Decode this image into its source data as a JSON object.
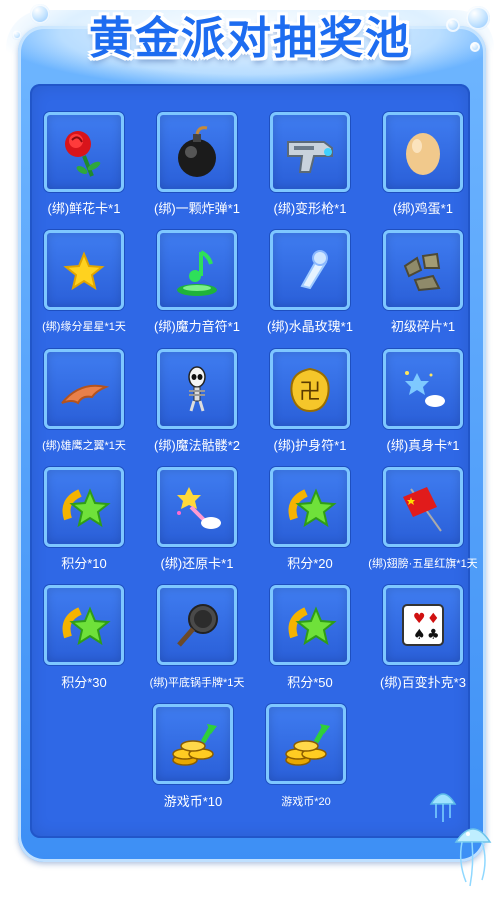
{
  "title": "黄金派对抽奖池",
  "items": [
    {
      "label": "(绑)鲜花卡*1",
      "icon": "rose-icon"
    },
    {
      "label": "(绑)一颗炸弹*1",
      "icon": "bomb-icon"
    },
    {
      "label": "(绑)变形枪*1",
      "icon": "transform-gun-icon"
    },
    {
      "label": "(绑)鸡蛋*1",
      "icon": "egg-icon"
    },
    {
      "label": "(绑)缘分星星*1天",
      "icon": "star-icon"
    },
    {
      "label": "(绑)魔力音符*1",
      "icon": "music-note-icon"
    },
    {
      "label": "(绑)水晶玫瑰*1",
      "icon": "crystal-rose-icon"
    },
    {
      "label": "初级碎片*1",
      "icon": "fragment-icon"
    },
    {
      "label": "(绑)雄鹰之翼*1天",
      "icon": "eagle-wing-icon"
    },
    {
      "label": "(绑)魔法骷髅*2",
      "icon": "skeleton-icon"
    },
    {
      "label": "(绑)护身符*1",
      "icon": "amulet-icon"
    },
    {
      "label": "(绑)真身卡*1",
      "icon": "true-form-card-icon"
    },
    {
      "label": "积分*10",
      "icon": "points-icon"
    },
    {
      "label": "(绑)还原卡*1",
      "icon": "restore-card-icon"
    },
    {
      "label": "积分*20",
      "icon": "points-icon"
    },
    {
      "label": "(绑)翅膀·五星红旗*1天",
      "icon": "flag-wing-icon"
    },
    {
      "label": "积分*30",
      "icon": "points-icon"
    },
    {
      "label": "(绑)平底锅手牌*1天",
      "icon": "frying-pan-icon"
    },
    {
      "label": "积分*50",
      "icon": "points-icon"
    },
    {
      "label": "(绑)百变扑克*3",
      "icon": "poker-card-icon"
    },
    {
      "label": "游戏币*10",
      "icon": "game-coins-icon"
    },
    {
      "label": "游戏币*20",
      "icon": "game-coins-icon"
    }
  ],
  "colors": {
    "panel": "#2f68e6",
    "frame": "#6fb6ff",
    "card_border": "#7ec7ff",
    "title": "#1d6cf0"
  }
}
